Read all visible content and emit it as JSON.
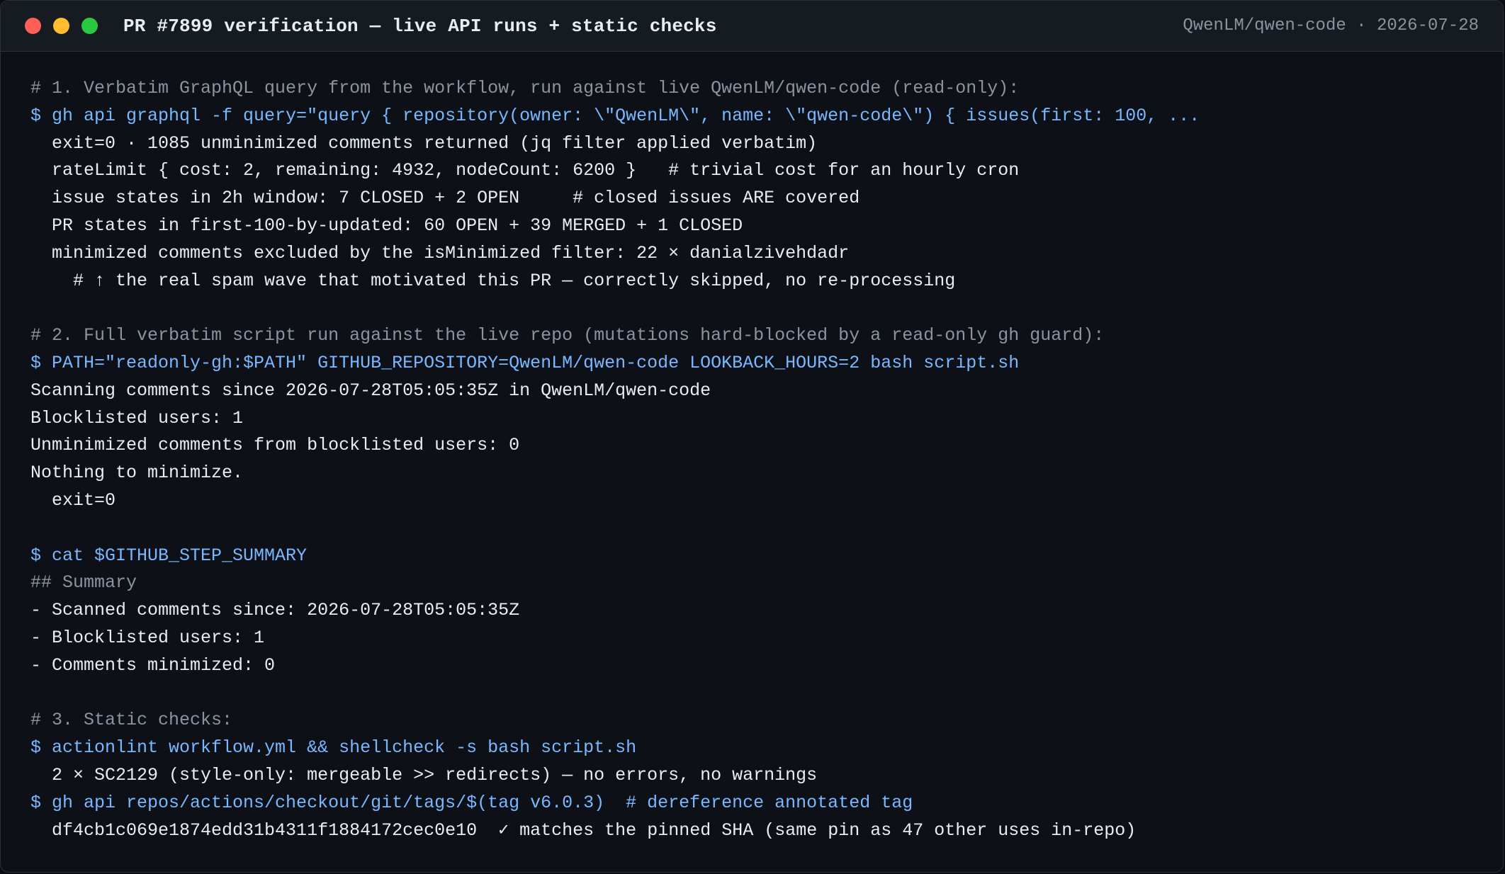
{
  "window": {
    "title": "PR #7899 verification — live API runs + static checks",
    "meta": "QwenLM/qwen-code · 2026-07-28"
  },
  "lines": [
    {
      "kind": "comment",
      "text": "# 1. Verbatim GraphQL query from the workflow, run against live QwenLM/qwen-code (read-only):"
    },
    {
      "kind": "cmd",
      "text": "$ gh api graphql -f query=\"query { repository(owner: \\\"QwenLM\\\", name: \\\"qwen-code\\\") { issues(first: 100, ..."
    },
    {
      "kind": "out",
      "text": "  exit=0 · 1085 unminimized comments returned (jq filter applied verbatim)"
    },
    {
      "kind": "out",
      "text": "  rateLimit { cost: 2, remaining: 4932, nodeCount: 6200 }   # trivial cost for an hourly cron"
    },
    {
      "kind": "out",
      "text": "  issue states in 2h window: 7 CLOSED + 2 OPEN     # closed issues ARE covered"
    },
    {
      "kind": "out",
      "text": "  PR states in first-100-by-updated: 60 OPEN + 39 MERGED + 1 CLOSED"
    },
    {
      "kind": "out",
      "text": "  minimized comments excluded by the isMinimized filter: 22 × danialzivehdadr"
    },
    {
      "kind": "out",
      "text": "    # ↑ the real spam wave that motivated this PR — correctly skipped, no re-processing"
    },
    {
      "kind": "blank",
      "text": ""
    },
    {
      "kind": "comment",
      "text": "# 2. Full verbatim script run against the live repo (mutations hard-blocked by a read-only gh guard):"
    },
    {
      "kind": "cmd",
      "text": "$ PATH=\"readonly-gh:$PATH\" GITHUB_REPOSITORY=QwenLM/qwen-code LOOKBACK_HOURS=2 bash script.sh"
    },
    {
      "kind": "out",
      "text": "Scanning comments since 2026-07-28T05:05:35Z in QwenLM/qwen-code"
    },
    {
      "kind": "out",
      "text": "Blocklisted users: 1"
    },
    {
      "kind": "out",
      "text": "Unminimized comments from blocklisted users: 0"
    },
    {
      "kind": "out",
      "text": "Nothing to minimize."
    },
    {
      "kind": "out",
      "text": "  exit=0"
    },
    {
      "kind": "blank",
      "text": ""
    },
    {
      "kind": "cmd",
      "text": "$ cat $GITHUB_STEP_SUMMARY"
    },
    {
      "kind": "comment",
      "text": "## Summary"
    },
    {
      "kind": "out",
      "text": "- Scanned comments since: 2026-07-28T05:05:35Z"
    },
    {
      "kind": "out",
      "text": "- Blocklisted users: 1"
    },
    {
      "kind": "out",
      "text": "- Comments minimized: 0"
    },
    {
      "kind": "blank",
      "text": ""
    },
    {
      "kind": "comment",
      "text": "# 3. Static checks:"
    },
    {
      "kind": "cmd",
      "text": "$ actionlint workflow.yml && shellcheck -s bash script.sh"
    },
    {
      "kind": "out",
      "text": "  2 × SC2129 (style-only: mergeable >> redirects) — no errors, no warnings"
    },
    {
      "kind": "cmd",
      "text": "$ gh api repos/actions/checkout/git/tags/$(tag v6.0.3)  # dereference annotated tag"
    },
    {
      "kind": "out",
      "text": "  df4cb1c069e1874edd31b4311f1884172cec0e10  ✓ matches the pinned SHA (same pin as 47 other uses in-repo)"
    }
  ],
  "colors": {
    "comment": "#8b949e",
    "command": "#79b8ff",
    "output": "#e6edf3",
    "background": "#0d1117",
    "titlebar": "#161b22"
  },
  "icons": [
    "close-dot-icon",
    "minimize-dot-icon",
    "zoom-dot-icon"
  ]
}
